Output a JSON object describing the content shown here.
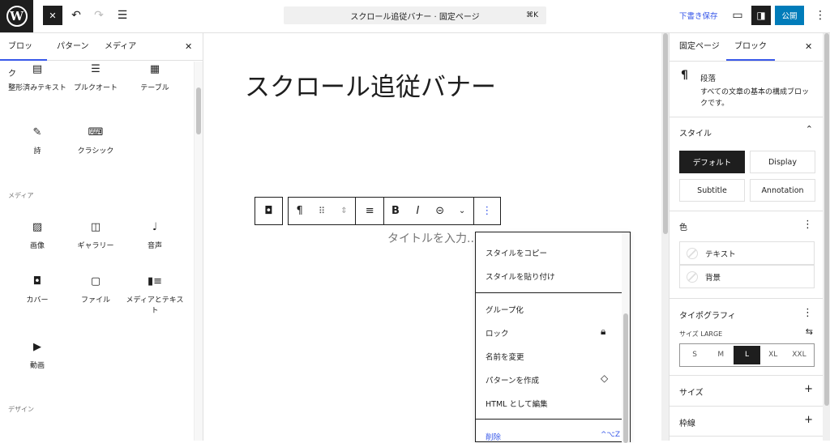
{
  "topbar": {
    "document_title": "スクロール追従バナー · 固定ページ",
    "shortcut": "⌘K",
    "save_draft": "下書き保存",
    "publish": "公開",
    "accent": "#3858e9",
    "publish_color": "#007cba"
  },
  "inserter": {
    "tabs": [
      "ブロック",
      "パターン",
      "メディア"
    ],
    "text_blocks": [
      {
        "icon": "preformatted-icon",
        "label": "整形済みテキスト"
      },
      {
        "icon": "pullquote-icon",
        "label": "プルクオート"
      },
      {
        "icon": "table-icon",
        "label": "テーブル"
      },
      {
        "icon": "verse-icon",
        "label": "詩"
      },
      {
        "icon": "classic-icon",
        "label": "クラシック"
      }
    ],
    "media_section": "メディア",
    "media_blocks": [
      {
        "icon": "image-icon",
        "label": "画像"
      },
      {
        "icon": "gallery-icon",
        "label": "ギャラリー"
      },
      {
        "icon": "audio-icon",
        "label": "音声"
      },
      {
        "icon": "cover-icon",
        "label": "カバー"
      },
      {
        "icon": "file-icon",
        "label": "ファイル"
      },
      {
        "icon": "media-text-icon",
        "label": "メディアとテキスト"
      },
      {
        "icon": "video-icon",
        "label": "動画"
      }
    ],
    "design_section": "デザイン"
  },
  "canvas": {
    "title": "スクロール追従バナー",
    "placeholder": "タイトルを入力..."
  },
  "menu": {
    "items": [
      "スタイルをコピー",
      "スタイルを貼り付け",
      "グループ化",
      "ロック",
      "名前を変更",
      "パターンを作成",
      "HTML として編集"
    ],
    "delete": "削除",
    "delete_shortcut": "^⌥Z"
  },
  "sidebar": {
    "tabs": [
      "固定ページ",
      "ブロック"
    ],
    "block_name": "段落",
    "block_desc": "すべての文章の基本の構成ブロックです。",
    "styles_heading": "スタイル",
    "styles": [
      "デフォルト",
      "Display",
      "Subtitle",
      "Annotation"
    ],
    "active_style": "デフォルト",
    "color_heading": "色",
    "colors": [
      "テキスト",
      "背景"
    ],
    "typography_heading": "タイポグラフィ",
    "size_label": "サイズ",
    "size_value": "LARGE",
    "sizes": [
      "S",
      "M",
      "L",
      "XL",
      "XXL"
    ],
    "active_size": "L",
    "dimensions_heading": "サイズ",
    "border_heading": "枠線"
  }
}
